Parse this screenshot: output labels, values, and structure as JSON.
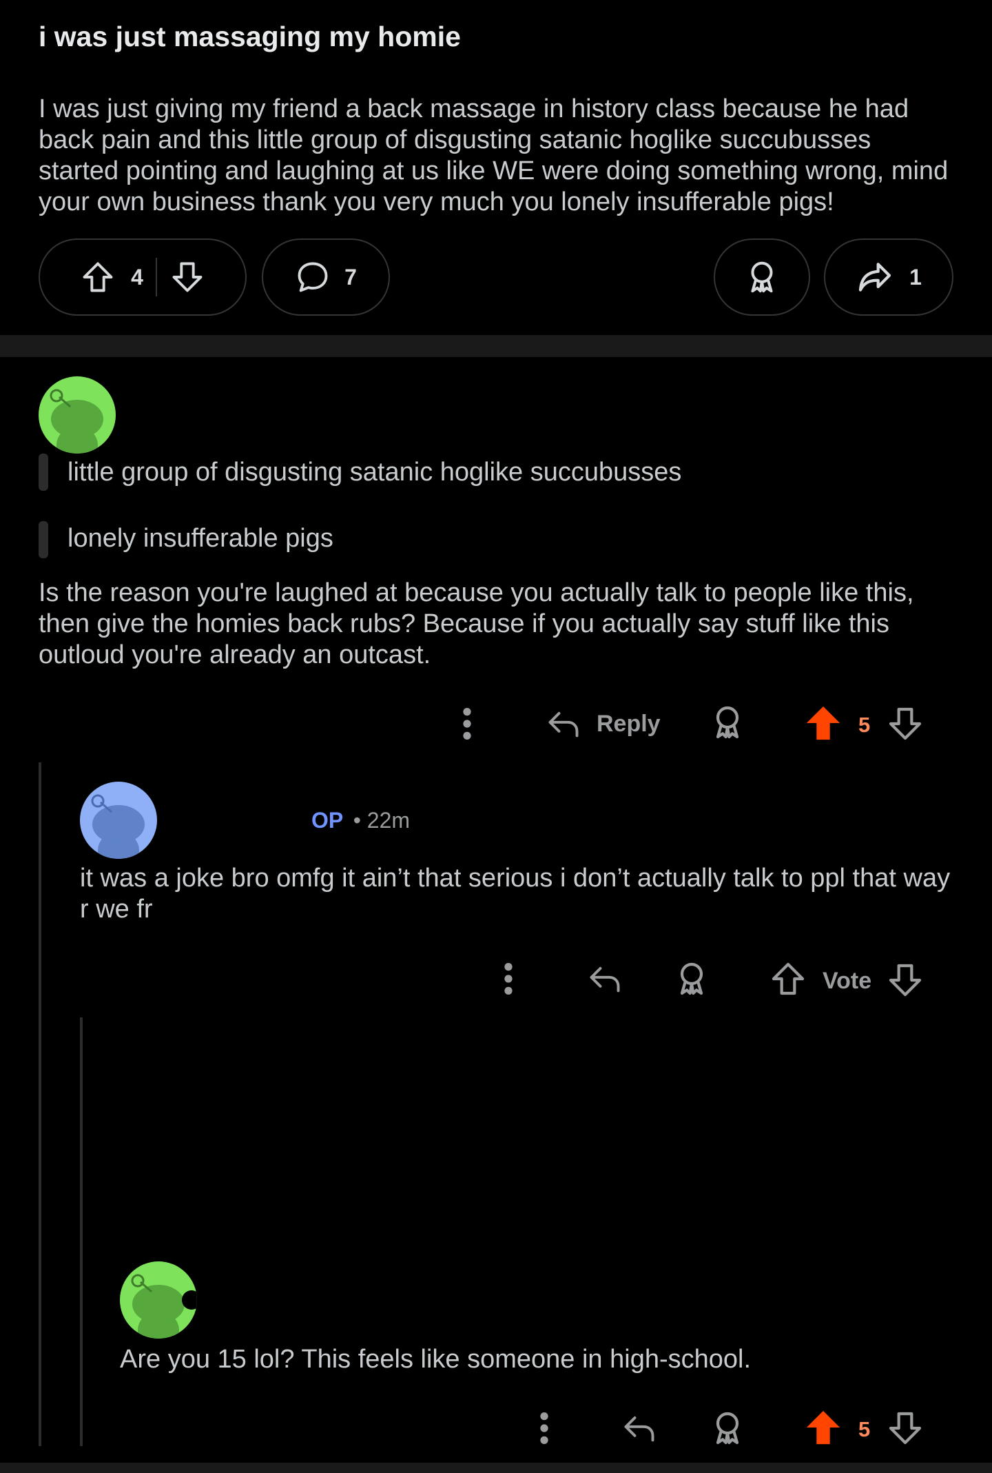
{
  "post": {
    "title": "i was just massaging my homie",
    "body": "I was just giving my friend a back massage in history class because he had back pain and this little group of disgusting satanic hoglike succubusses started pointing and laughing at us like WE were doing something wrong, mind your own business thank you very much you lonely insufferable pigs!",
    "upvotes": "4",
    "comments": "7",
    "shares": "1"
  },
  "comment1": {
    "quotes": [
      "little group of disgusting satanic hoglike succubusses",
      "lonely insufferable pigs"
    ],
    "body": "Is the reason you're laughed at because you actually talk to people like this, then give the homies back rubs? Because if you actually say stuff like this outloud you're already an outcast.",
    "reply_label": "Reply",
    "score": "5"
  },
  "comment2": {
    "op_tag": "OP",
    "time": "• 22m",
    "body": "it was a joke bro omfg it ain’t that serious i don’t actually talk to ppl that way r we fr",
    "vote_label": "Vote"
  },
  "comment3": {
    "body": "Are you 15 lol? This feels like someone in high-school.",
    "score": "5"
  },
  "colors": {
    "upvote_active": "#ff4500",
    "op_blue": "#7193ff",
    "avatar_green": "#7ee35b",
    "avatar_blue": "#8fb0f7"
  },
  "icons": [
    "upvote-icon",
    "downvote-icon",
    "comment-icon",
    "award-icon",
    "share-icon",
    "reply-icon",
    "more-icon"
  ]
}
